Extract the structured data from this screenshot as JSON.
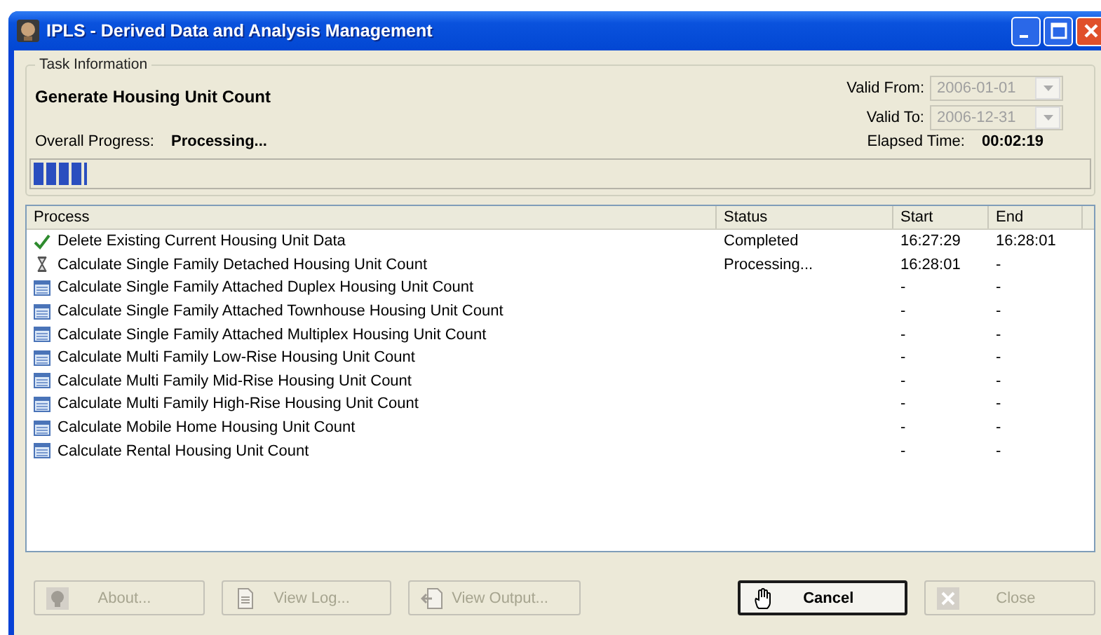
{
  "window": {
    "title": "IPLS - Derived Data and Analysis Management"
  },
  "task": {
    "group_label": "Task Information",
    "name": "Generate Housing Unit Count",
    "valid_from_label": "Valid From:",
    "valid_from": "2006-01-01",
    "valid_to_label": "Valid To:",
    "valid_to": "2006-12-31",
    "progress_label": "Overall Progress:",
    "progress_status": "Processing...",
    "elapsed_label": "Elapsed Time:",
    "elapsed": "00:02:19",
    "level": 0.05
  },
  "table": {
    "columns": [
      "Process",
      "Status",
      "Start",
      "End"
    ],
    "rows": [
      {
        "kind": "done",
        "process": "Delete Existing Current Housing Unit Data",
        "status": "Completed",
        "start": "16:27:29",
        "end": "16:28:01"
      },
      {
        "kind": "running",
        "process": "Calculate Single Family Detached Housing Unit Count",
        "status": "Processing...",
        "start": "16:28:01",
        "end": "-"
      },
      {
        "kind": "pending",
        "process": "Calculate Single Family Attached Duplex Housing Unit Count",
        "start": "-",
        "end": "-"
      },
      {
        "kind": "pending",
        "process": "Calculate Single Family Attached Townhouse Housing Unit Count",
        "start": "-",
        "end": "-"
      },
      {
        "kind": "pending",
        "process": "Calculate Single Family Attached Multiplex Housing Unit Count",
        "start": "-",
        "end": "-"
      },
      {
        "kind": "pending",
        "process": "Calculate Multi Family Low-Rise Housing Unit Count",
        "start": "-",
        "end": "-"
      },
      {
        "kind": "pending",
        "process": "Calculate Multi Family Mid-Rise Housing Unit Count",
        "start": "-",
        "end": "-"
      },
      {
        "kind": "pending",
        "process": "Calculate Multi Family High-Rise Housing Unit Count",
        "start": "-",
        "end": "-"
      },
      {
        "kind": "pending",
        "process": "Calculate Mobile Home Housing Unit Count",
        "start": "-",
        "end": "-"
      },
      {
        "kind": "pending",
        "process": "Calculate Rental Housing Unit Count",
        "start": "-",
        "end": "-"
      }
    ]
  },
  "buttons": [
    {
      "kind": "about",
      "label": "About...",
      "disabled": true
    },
    {
      "kind": "log",
      "label": "View Log...",
      "disabled": true
    },
    {
      "kind": "output",
      "label": "View Output...",
      "disabled": true
    },
    {
      "kind": "cancel",
      "label": "Cancel",
      "disabled": false
    },
    {
      "kind": "close",
      "label": "Close",
      "disabled": true
    }
  ]
}
